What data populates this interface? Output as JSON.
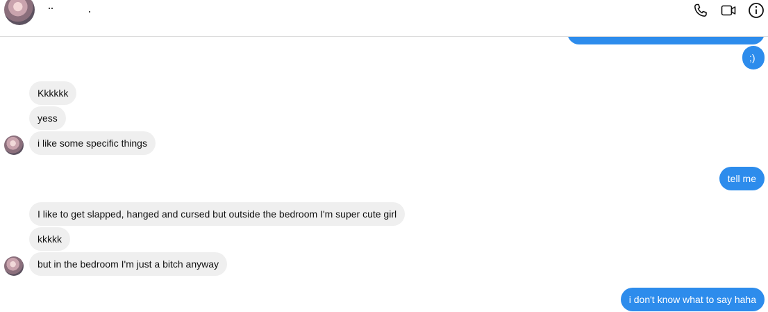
{
  "header": {
    "contact_name": "",
    "icons": {
      "call": "phone-icon",
      "video": "video-camera-icon",
      "info": "info-icon"
    }
  },
  "messages": [
    {
      "from": "me",
      "text": ""
    },
    {
      "from": "me",
      "text": ";)"
    },
    {
      "from": "them",
      "text": "Kkkkkk"
    },
    {
      "from": "them",
      "text": "yess"
    },
    {
      "from": "them",
      "text": "i like some specific things"
    },
    {
      "from": "me",
      "text": "tell me"
    },
    {
      "from": "them",
      "text": "I like to get slapped, hanged and cursed but outside the bedroom I'm super cute girl"
    },
    {
      "from": "them",
      "text": "kkkkk"
    },
    {
      "from": "them",
      "text": "but in the bedroom I'm just a bitch anyway"
    },
    {
      "from": "me",
      "text": "i don't know what to say haha"
    }
  ],
  "colors": {
    "outgoing_bubble": "#2d8cec",
    "incoming_bubble": "#efefef",
    "divider": "#dcdcdc"
  }
}
